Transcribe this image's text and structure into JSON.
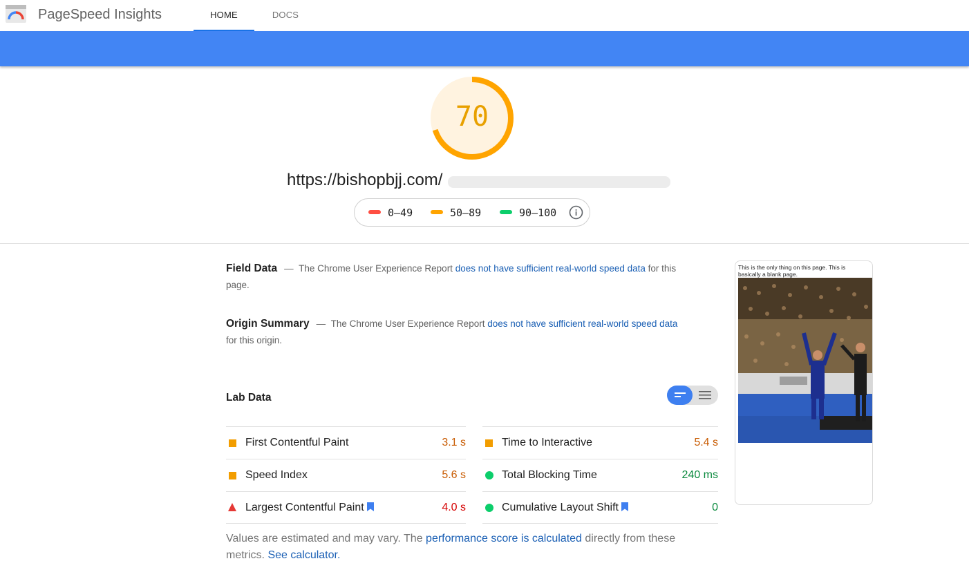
{
  "header": {
    "app_title": "PageSpeed Insights",
    "tabs": [
      {
        "label": "HOME",
        "active": true
      },
      {
        "label": "DOCS",
        "active": false
      }
    ],
    "band_color": "#4285f4"
  },
  "score": {
    "value": "70",
    "fraction": 0.7,
    "color": "#ffa400"
  },
  "url": "https://bishopbjj.com/",
  "legend": {
    "fail": {
      "label": "0–49",
      "color": "#ff4e42"
    },
    "average": {
      "label": "50–89",
      "color": "#ffa400"
    },
    "pass": {
      "label": "90–100",
      "color": "#0cce6b"
    },
    "icon": "info-icon"
  },
  "field_data": {
    "heading": "Field Data",
    "dash": "—",
    "text_before": "The Chrome User Experience Report",
    "link": "does not have sufficient real-world speed data",
    "text_after": "for this page."
  },
  "origin_summary": {
    "heading": "Origin Summary",
    "dash": "—",
    "text_before": "The Chrome User Experience Report",
    "link": "does not have sufficient real-world speed data",
    "text_after": "for this origin."
  },
  "lab_data": {
    "title": "Lab Data",
    "toggle_icons": [
      "bar-view-icon",
      "list-view-icon"
    ],
    "metrics_left": [
      {
        "label": "First Contentful Paint",
        "value": "3.1 s",
        "status": "average",
        "bookmark": false
      },
      {
        "label": "Speed Index",
        "value": "5.6 s",
        "status": "average",
        "bookmark": false
      },
      {
        "label": "Largest Contentful Paint",
        "value": "4.0 s",
        "status": "fail",
        "bookmark": true
      }
    ],
    "metrics_right": [
      {
        "label": "Time to Interactive",
        "value": "5.4 s",
        "status": "average",
        "bookmark": false
      },
      {
        "label": "Total Blocking Time",
        "value": "240 ms",
        "status": "pass",
        "bookmark": false
      },
      {
        "label": "Cumulative Layout Shift",
        "value": "0",
        "status": "pass",
        "bookmark": true
      }
    ]
  },
  "footnote": {
    "text_before": "Values are estimated and may vary. The",
    "link1": "performance score is calculated",
    "text_middle": "directly from these metrics.",
    "link2": "See calculator."
  },
  "screenshot": {
    "caption": "This is the only thing on this page. This is basically a blank page."
  }
}
